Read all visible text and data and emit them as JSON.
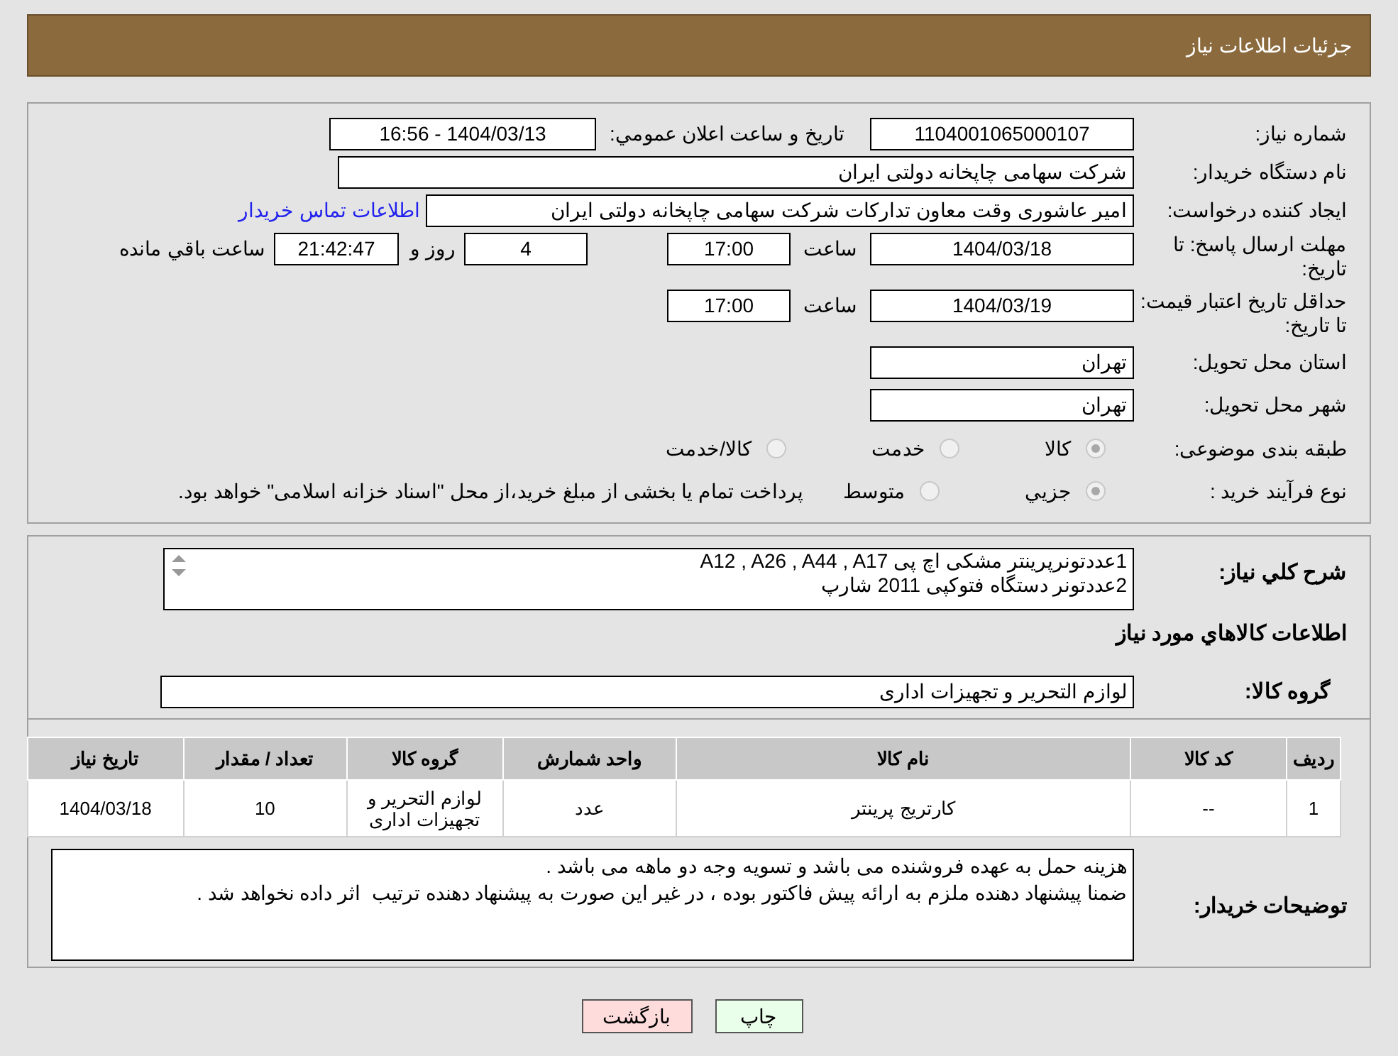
{
  "header": {
    "title": "جزئیات اطلاعات نیاز"
  },
  "fields": {
    "need_number": {
      "label": "شماره نیاز:",
      "value": "1104001065000107"
    },
    "announce": {
      "label": "تاریخ و ساعت اعلان عمومي:",
      "value": "1404/03/13 - 16:56"
    },
    "buyer_org": {
      "label": "نام دستگاه خریدار:",
      "value": "شرکت سهامی چاپخانه دولتی ایران"
    },
    "requester": {
      "label": "ایجاد کننده درخواست:",
      "value": "امیر عاشوری وقت معاون تدارکات شرکت سهامی چاپخانه دولتی ایران",
      "link": "اطلاعات تماس خریدار"
    },
    "reply_deadline": {
      "label": "مهلت ارسال پاسخ: تا تاریخ:",
      "date": "1404/03/18",
      "time_label": "ساعت",
      "time": "17:00",
      "days": "4",
      "days_label": "روز و",
      "remaining": "21:42:47",
      "remaining_label": "ساعت باقي مانده"
    },
    "price_validity": {
      "label": "حداقل تاریخ اعتبار قیمت: تا تاریخ:",
      "date": "1404/03/19",
      "time_label": "ساعت",
      "time": "17:00"
    },
    "province": {
      "label": "استان محل تحویل:",
      "value": "تهران"
    },
    "city": {
      "label": "شهر محل تحویل:",
      "value": "تهران"
    },
    "category": {
      "label": "طبقه بندی موضوعی:",
      "options": [
        {
          "label": "كالا",
          "selected": true
        },
        {
          "label": "خدمت",
          "selected": false
        },
        {
          "label": "كالا/خدمت",
          "selected": false
        }
      ]
    },
    "purchase_type": {
      "label": "نوع فرآیند خرید :",
      "options": [
        {
          "label": "جزيي",
          "selected": true
        },
        {
          "label": "متوسط",
          "selected": false
        }
      ],
      "note": "پرداخت تمام یا بخشی از مبلغ خرید،از محل \"اسناد خزانه اسلامی\" خواهد بود."
    }
  },
  "description": {
    "label": "شرح كلي نياز:",
    "lines": [
      "1عددتونرپرینتر مشکی اچ پی A12 , A26 , A44 , A17",
      "2عددتونر دستگاه فتوکپی 2011 شارپ"
    ]
  },
  "goods_heading": "اطلاعات كالاهاي مورد نياز",
  "goods_group": {
    "label": "گروه كالا:",
    "value": "لوازم التحریر و تجهیزات اداری"
  },
  "table": {
    "columns": [
      "ردیف",
      "کد کالا",
      "نام کالا",
      "واحد شمارش",
      "گروه کالا",
      "تعداد / مقدار",
      "تاریخ نیاز"
    ],
    "rows": [
      [
        "1",
        "--",
        "کارتریج پرینتر",
        "عدد",
        "لوازم التحریر و تجهیزات اداری",
        "10",
        "1404/03/18"
      ]
    ]
  },
  "buyer_notes": {
    "label": "توضیحات خریدار:",
    "lines": [
      "هزینه حمل به عهده فروشنده می باشد و تسویه وجه دو ماهه می باشد .",
      "ضمنا پیشنهاد دهنده ملزم به ارائه پیش فاکتور بوده ، در غیر این صورت به پیشنهاد دهنده ترتیب  اثر داده نخواهد شد ."
    ]
  },
  "buttons": [
    {
      "kind": "print",
      "label": "چاپ"
    },
    {
      "kind": "back",
      "label": "بازگشت"
    }
  ]
}
